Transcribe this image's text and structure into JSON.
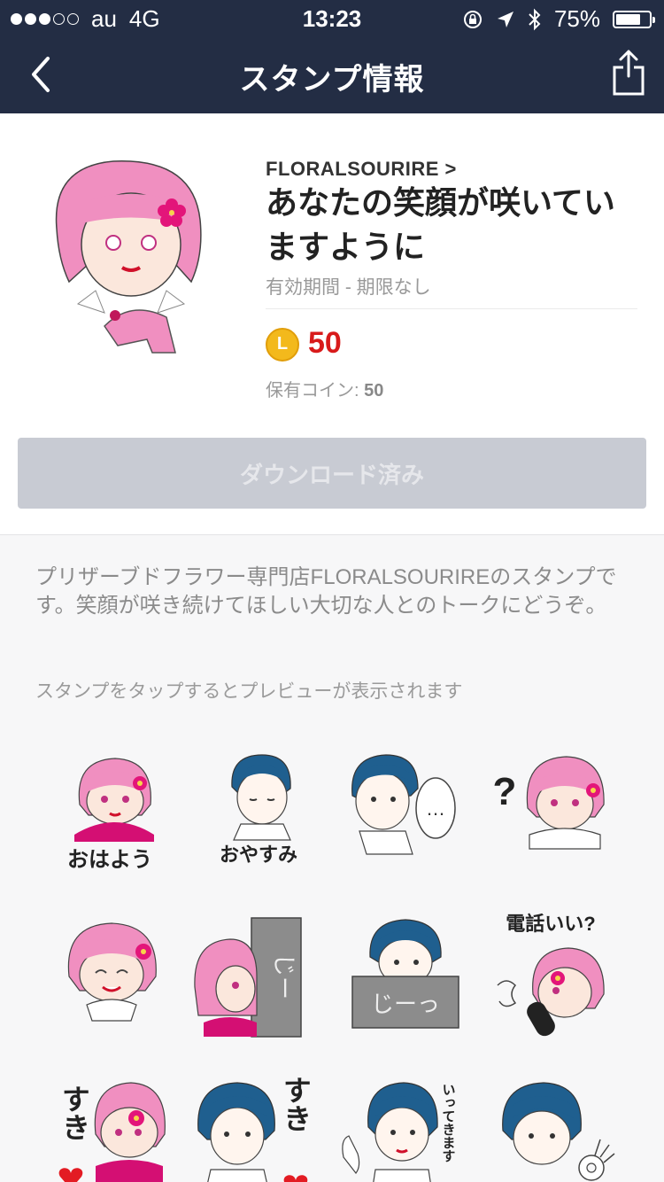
{
  "status_bar": {
    "carrier": "au",
    "network": "4G",
    "time": "13:23",
    "battery": "75%",
    "battery_level": 0.75
  },
  "nav": {
    "title": "スタンプ情報"
  },
  "sticker_pack": {
    "creator": "FLORALSOURIRE >",
    "title": "あなたの笑顔が咲いていますように",
    "validity": "有効期間 - 期限なし",
    "coin_symbol": "L",
    "price": "50",
    "owned_label": "保有コイン: ",
    "owned_value": "50",
    "download_label": "ダウンロード済み"
  },
  "description": "プリザーブドフラワー専門店FLORALSOURIREのスタンプです。笑顔が咲き続けてほしい大切な人とのトークにどうぞ。",
  "preview_hint": "スタンプをタップするとプレビューが表示されます",
  "stickers": [
    {
      "caption": "おはよう"
    },
    {
      "caption": "おやすみ"
    },
    {
      "caption": "…"
    },
    {
      "caption": "?"
    },
    {
      "caption": ""
    },
    {
      "caption": "じー"
    },
    {
      "caption": "じーっ"
    },
    {
      "caption": "電話いい?"
    },
    {
      "caption": "すき"
    },
    {
      "caption": "すき"
    },
    {
      "caption": "いってきます"
    },
    {
      "caption": ""
    }
  ],
  "colors": {
    "header": "#232d44",
    "price": "#d81a1a",
    "coin": "#f3b91c",
    "pink_hair": "#f08fc0",
    "blue_hair": "#1f5f8f"
  }
}
